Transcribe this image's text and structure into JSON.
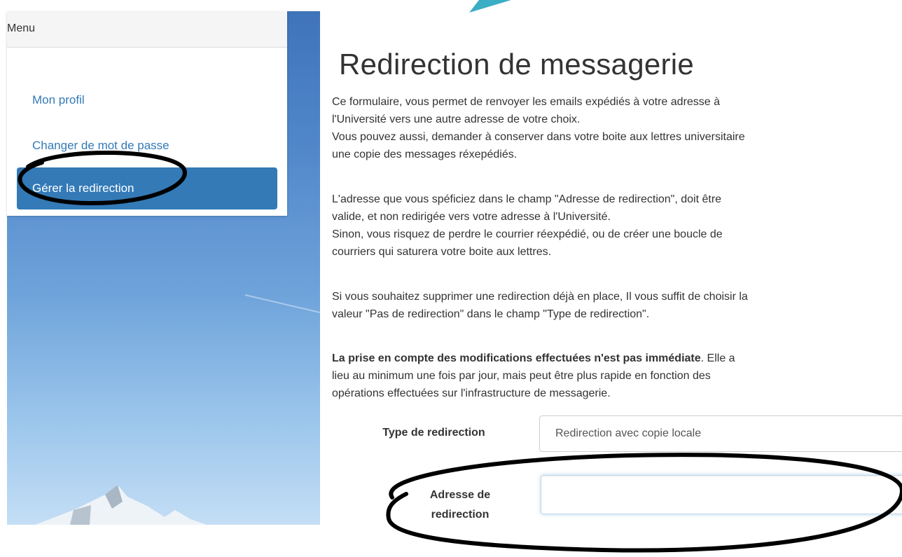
{
  "menu": {
    "header": "Menu",
    "items": [
      {
        "label": "Mon profil"
      },
      {
        "label": "Changer de mot de passe"
      },
      {
        "label": "Gérer la redirection"
      }
    ]
  },
  "main": {
    "title": "Redirection de messagerie",
    "para1_line1": "Ce formulaire, vous permet de renvoyer les emails expédiés à votre adresse à",
    "para1_line2": "l'Université vers une autre adresse de votre choix.",
    "para1_line3": "Vous pouvez aussi, demander à conserver dans votre boite aux lettres universitaire",
    "para1_line4": "une copie des messages réxepédiés.",
    "para2_line1": "L'adresse que vous spéficiez dans le champ \"Adresse de redirection\", doit être",
    "para2_line2": "valide, et non redirigée vers votre adresse à l'Université.",
    "para2_line3": "Sinon, vous risquez de perdre le courrier réexpédié, ou de créer une boucle de",
    "para2_line4": "courriers qui saturera votre boite aux lettres.",
    "para3_line1": "Si vous souhaitez supprimer une redirection déjà en place, Il vous suffit de choisir la",
    "para3_line2": "valeur \"Pas de redirection\" dans le champ \"Type de redirection\".",
    "para4_bold": "La prise en compte des modifications effectuées n'est pas immédiate",
    "para4_rest": ". Elle a",
    "para4_line2": "lieu au minimum une fois par jour, mais peut être plus rapide en fonction des",
    "para4_line3": "opérations effectuées sur l'infrastructure de messagerie."
  },
  "form": {
    "type_label": "Type de redirection",
    "type_value": "Redirection avec copie locale",
    "address_label_line1": "Adresse de",
    "address_label_line2": "redirection",
    "address_value": ""
  },
  "colors": {
    "link": "#337ab7",
    "active_bg": "#337ab7",
    "annotation": "#000000",
    "teal_mark": "#3aaec4"
  }
}
